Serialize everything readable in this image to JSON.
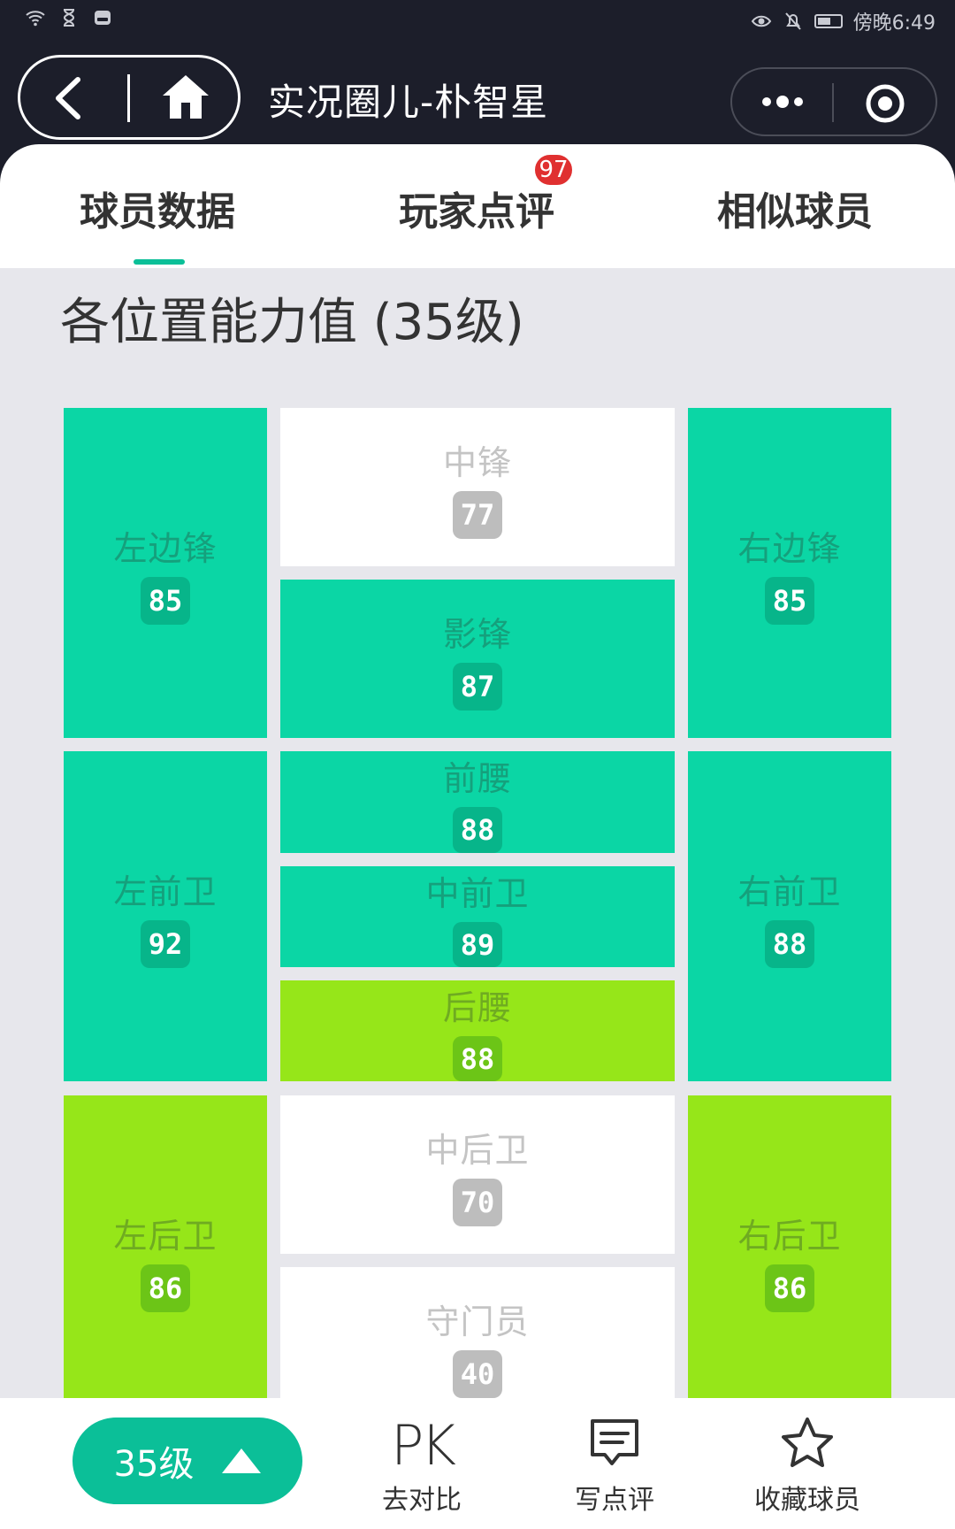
{
  "status_bar": {
    "time": "傍晚6:49"
  },
  "nav": {
    "title": "实况圈儿-朴智星"
  },
  "tabs": [
    {
      "label": "球员数据"
    },
    {
      "label": "玩家点评",
      "badge": "97"
    },
    {
      "label": "相似球员"
    }
  ],
  "section_title": "各位置能力值 (35级)",
  "positions": {
    "lwf": {
      "label": "左边锋",
      "value": "85",
      "color": "#0bd6a5"
    },
    "cf": {
      "label": "中锋",
      "value": "77",
      "color": "#ffffff"
    },
    "rwf": {
      "label": "右边锋",
      "value": "85",
      "color": "#0bd6a5"
    },
    "ss": {
      "label": "影锋",
      "value": "87",
      "color": "#0bd6a5"
    },
    "amf": {
      "label": "前腰",
      "value": "88",
      "color": "#0bd6a5"
    },
    "lmf": {
      "label": "左前卫",
      "value": "92",
      "color": "#0bd6a5"
    },
    "cmf": {
      "label": "中前卫",
      "value": "89",
      "color": "#0bd6a5"
    },
    "rmf": {
      "label": "右前卫",
      "value": "88",
      "color": "#0bd6a5"
    },
    "dmf": {
      "label": "后腰",
      "value": "88",
      "color": "#96e619"
    },
    "lb": {
      "label": "左后卫",
      "value": "86",
      "color": "#96e619"
    },
    "cb": {
      "label": "中后卫",
      "value": "70",
      "color": "#ffffff"
    },
    "rb": {
      "label": "右后卫",
      "value": "86",
      "color": "#96e619"
    },
    "gk": {
      "label": "守门员",
      "value": "40",
      "color": "#ffffff"
    }
  },
  "bottom_bar": {
    "level_button": "35级",
    "pk_icon_text": "PK",
    "compare_label": "去对比",
    "review_label": "写点评",
    "favorite_label": "收藏球员"
  }
}
